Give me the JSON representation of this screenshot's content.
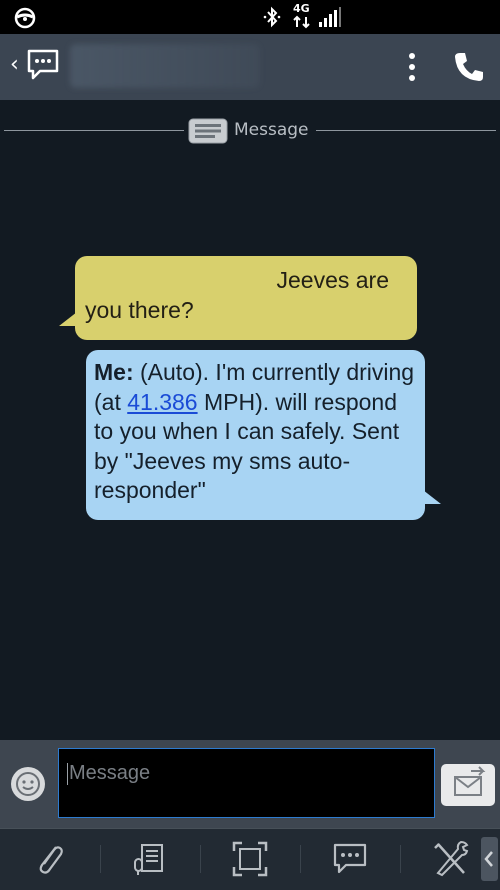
{
  "status_bar": {
    "network": "4G",
    "icons": [
      "steering-wheel-icon",
      "bluetooth-icon",
      "network-4g-icon",
      "signal-bars-icon"
    ]
  },
  "app_bar": {
    "icons": [
      "back-chevron-icon",
      "conversation-icon",
      "menu-icon",
      "call-icon"
    ]
  },
  "thread": {
    "divider_label": "Message",
    "incoming": {
      "line1": "Jeeves are",
      "line2": "you there?"
    },
    "outgoing": {
      "sender": "Me:",
      "text_before_link": "(Auto). I'm currently driving (at",
      "speed": "41.386",
      "text_after_link": "MPH). will respond to you when I can safely. Sent by \"Jeeves my sms auto-responder\""
    }
  },
  "composer": {
    "placeholder": "Message",
    "icons": [
      "emoji-icon",
      "send-icon"
    ]
  },
  "toolbar": {
    "items": [
      "attach-icon",
      "voice-memo-icon",
      "screenshot-icon",
      "quick-reply-icon",
      "tools-icon",
      "more-chevron-icon"
    ]
  },
  "colors": {
    "incoming_bubble": "#d8d06d",
    "outgoing_bubble": "#a8d4f3",
    "background": "#121a22",
    "link": "#1a4bd6"
  }
}
